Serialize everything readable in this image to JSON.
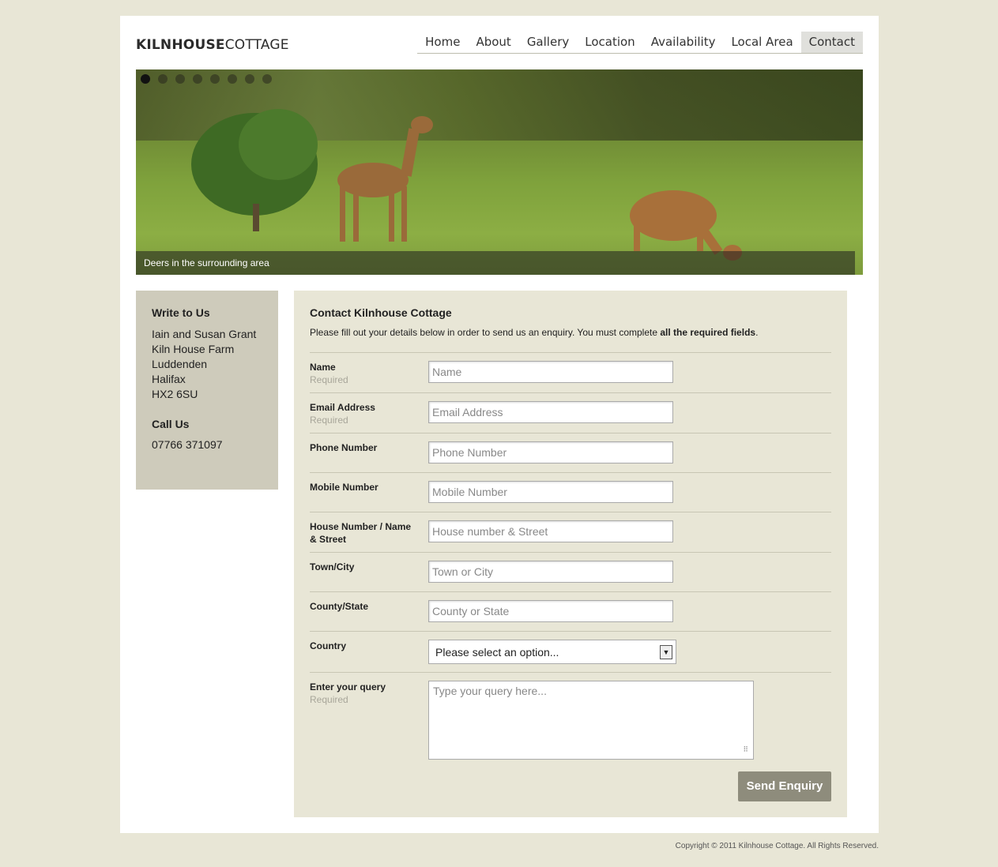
{
  "header": {
    "logo_bold": "KILNHOUSE",
    "logo_light": "COTTAGE",
    "nav": [
      {
        "label": "Home"
      },
      {
        "label": "About"
      },
      {
        "label": "Gallery"
      },
      {
        "label": "Location"
      },
      {
        "label": "Availability"
      },
      {
        "label": "Local Area"
      },
      {
        "label": "Contact"
      }
    ],
    "active": "Contact"
  },
  "banner": {
    "caption": "Deers in the surrounding area",
    "slide_count": 8,
    "active_slide": 1
  },
  "sidebar": {
    "write_title": "Write to Us",
    "address": [
      "Iain and Susan Grant",
      "Kiln House Farm",
      "Luddenden",
      "Halifax",
      "HX2 6SU"
    ],
    "call_title": "Call Us",
    "phone": "07766 371097"
  },
  "form": {
    "title": "Contact Kilnhouse Cottage",
    "intro_text": "Please fill out your details below in order to send us an enquiry. You must complete ",
    "intro_bold": "all the required fields",
    "intro_end": ".",
    "required_text": "Required",
    "fields": [
      {
        "label": "Name",
        "placeholder": "Name",
        "required": true
      },
      {
        "label": "Email Address",
        "placeholder": "Email Address",
        "required": true
      },
      {
        "label": "Phone Number",
        "placeholder": "Phone Number",
        "required": false
      },
      {
        "label": "Mobile Number",
        "placeholder": "Mobile Number",
        "required": false
      },
      {
        "label": "House Number / Name & Street",
        "placeholder": "House number & Street",
        "required": false
      },
      {
        "label": "Town/City",
        "placeholder": "Town or City",
        "required": false
      },
      {
        "label": "County/State",
        "placeholder": "County or State",
        "required": false
      }
    ],
    "country_label": "Country",
    "country_value": "Please select an option...",
    "query_label": "Enter your query",
    "query_placeholder": "Type your query here...",
    "submit_label": "Send Enquiry"
  },
  "footer": {
    "copyright": "Copyright © 2011 Kilnhouse Cottage. All Rights Reserved."
  }
}
